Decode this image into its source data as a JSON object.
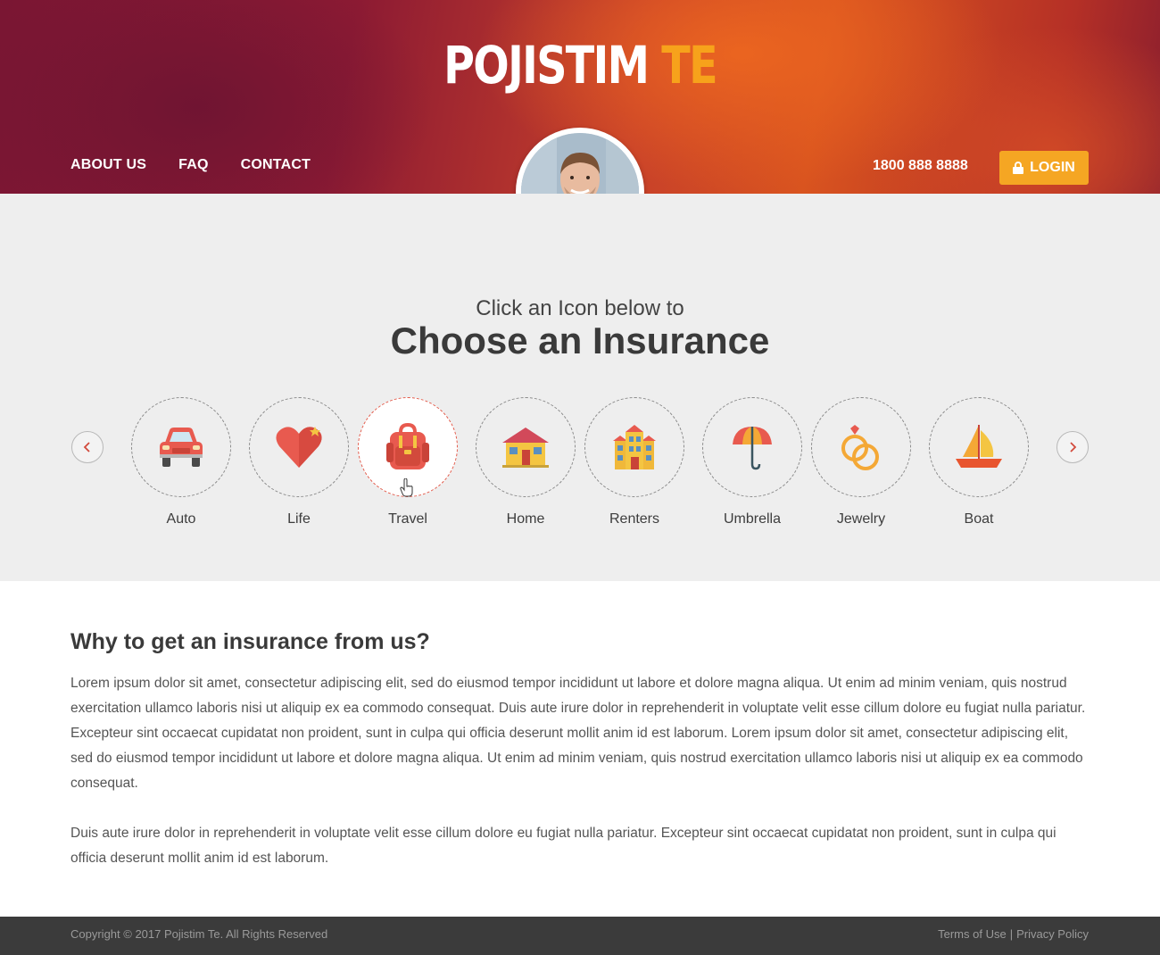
{
  "header": {
    "logo_main": "POJISTIM",
    "logo_accent": "TE",
    "nav": [
      {
        "label": "ABOUT US"
      },
      {
        "label": "FAQ"
      },
      {
        "label": "CONTACT"
      }
    ],
    "phone": "1800 888 8888",
    "login_label": "LOGIN",
    "colors": {
      "accent": "#f5a623",
      "logo_accent": "#f7a21b"
    }
  },
  "choose": {
    "subtitle": "Click an Icon below to",
    "title": "Choose an Insurance",
    "items": [
      {
        "label": "Auto",
        "icon": "car-icon"
      },
      {
        "label": "Life",
        "icon": "heart-icon"
      },
      {
        "label": "Travel",
        "icon": "backpack-icon",
        "active": true
      },
      {
        "label": "Home",
        "icon": "house-icon"
      },
      {
        "label": "Renters",
        "icon": "building-icon"
      },
      {
        "label": "Umbrella",
        "icon": "umbrella-icon"
      },
      {
        "label": "Jewelry",
        "icon": "rings-icon"
      },
      {
        "label": "Boat",
        "icon": "sailboat-icon"
      }
    ],
    "colors": {
      "active_border": "#e35a4a",
      "icon_red": "#e85a4f",
      "icon_yellow": "#f4c542"
    }
  },
  "why": {
    "title": "Why to get an insurance from us?",
    "paragraph1": "Lorem ipsum dolor sit amet, consectetur adipiscing elit, sed do eiusmod tempor incididunt ut labore et dolore magna aliqua. Ut enim ad minim veniam, quis nostrud exercitation ullamco laboris nisi ut aliquip ex ea commodo consequat. Duis aute irure dolor in reprehenderit in voluptate velit esse cillum dolore eu fugiat nulla pariatur. Excepteur sint occaecat cupidatat non proident, sunt in culpa qui officia deserunt mollit anim id est laborum. Lorem ipsum dolor sit amet, consectetur adipiscing elit, sed do eiusmod tempor incididunt ut labore et dolore magna aliqua. Ut enim ad minim veniam, quis nostrud exercitation ullamco laboris nisi ut aliquip ex ea commodo consequat.",
    "paragraph2": "Duis aute irure dolor in reprehenderit in voluptate velit esse cillum dolore eu fugiat nulla pariatur. Excepteur sint occaecat cupidatat non proident, sunt in culpa qui officia deserunt mollit anim id est laborum."
  },
  "footer": {
    "copyright": "Copyright © 2017 Pojistim Te. All Rights Reserved",
    "terms": "Terms of Use",
    "separator": "|",
    "privacy": "Privacy Policy"
  }
}
